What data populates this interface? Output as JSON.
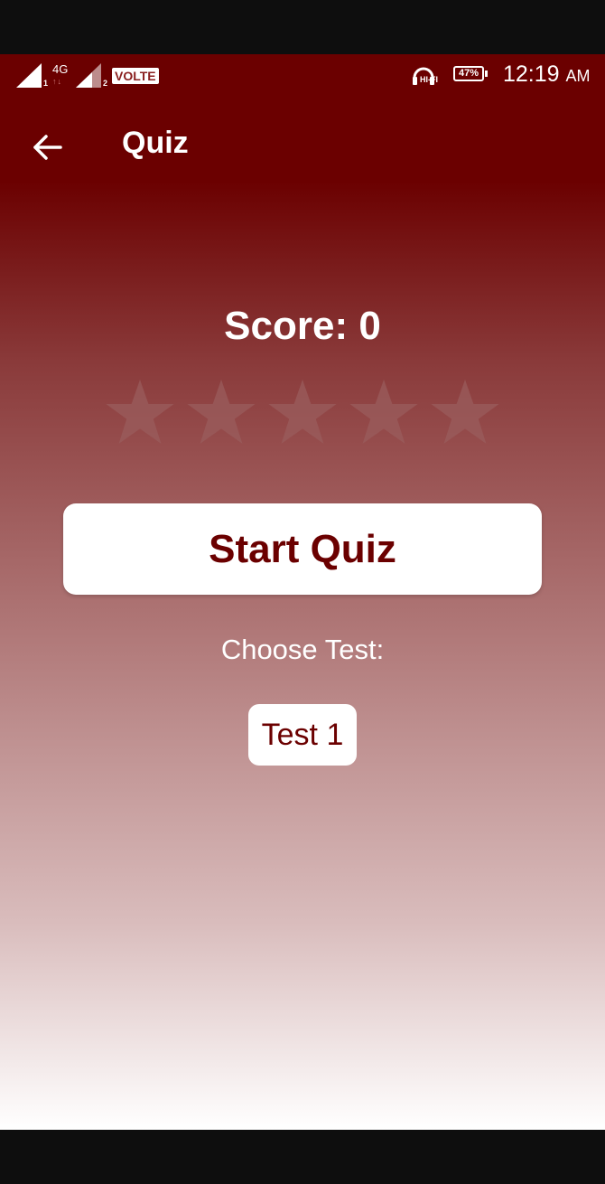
{
  "status_bar": {
    "sim1_slot": "1",
    "network_type": "4G",
    "sim2_slot": "2",
    "volte_label": "VOLTE",
    "hifi_label": "HI-FI",
    "battery_percent": "47%",
    "time": "12:19",
    "ampm": "AM"
  },
  "app_bar": {
    "back_icon": "arrow-left-icon",
    "title": "Quiz"
  },
  "main": {
    "score_text": "Score: 0",
    "star_rating": {
      "filled": 0,
      "total": 5
    },
    "start_button_label": "Start Quiz",
    "choose_label": "Choose Test:",
    "test_option_label": "Test 1"
  },
  "colors": {
    "primary": "#6b0000",
    "star_empty": "#9a5c5c",
    "button_bg": "#ffffff"
  }
}
